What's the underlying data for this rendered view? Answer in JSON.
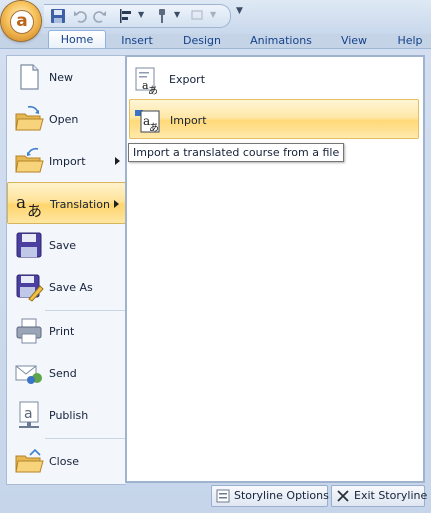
{
  "qat": {
    "icons": [
      "save-icon",
      "undo-icon",
      "redo-icon",
      "align-icon",
      "format-painter-icon",
      "customize-icon"
    ]
  },
  "tabs": [
    {
      "label": "Home",
      "active": true
    },
    {
      "label": "Insert",
      "active": false
    },
    {
      "label": "Design",
      "active": false
    },
    {
      "label": "Animations",
      "active": false
    },
    {
      "label": "View",
      "active": false
    },
    {
      "label": "Help",
      "active": false
    }
  ],
  "menu": {
    "items": [
      {
        "label": "New",
        "icon": "new-document-icon"
      },
      {
        "label": "Open",
        "icon": "open-folder-icon"
      },
      {
        "label": "Import",
        "icon": "import-folder-icon",
        "has_submenu": true
      },
      {
        "label": "Translation",
        "icon": "translation-icon",
        "has_submenu": true,
        "selected": true
      },
      {
        "label": "Save",
        "icon": "save-disk-icon"
      },
      {
        "label": "Save As",
        "icon": "save-as-icon"
      },
      {
        "label": "Print",
        "icon": "printer-icon"
      },
      {
        "label": "Send",
        "icon": "send-icon"
      },
      {
        "label": "Publish",
        "icon": "publish-icon"
      },
      {
        "label": "Close",
        "icon": "close-folder-icon"
      }
    ]
  },
  "submenu": {
    "items": [
      {
        "label": "Export",
        "icon": "export-translation-icon"
      },
      {
        "label": "Import",
        "icon": "import-translation-icon",
        "hovered": true
      }
    ],
    "tooltip": "Import a translated course from a file"
  },
  "bottom": {
    "options_label": "Storyline Options",
    "exit_label": "Exit Storyline"
  },
  "colors": {
    "selected_gradient_top": "#fff3cc",
    "selected_gradient_mid": "#ffd56c",
    "panel_bg": "#c6d5ea",
    "text": "#15223a"
  }
}
